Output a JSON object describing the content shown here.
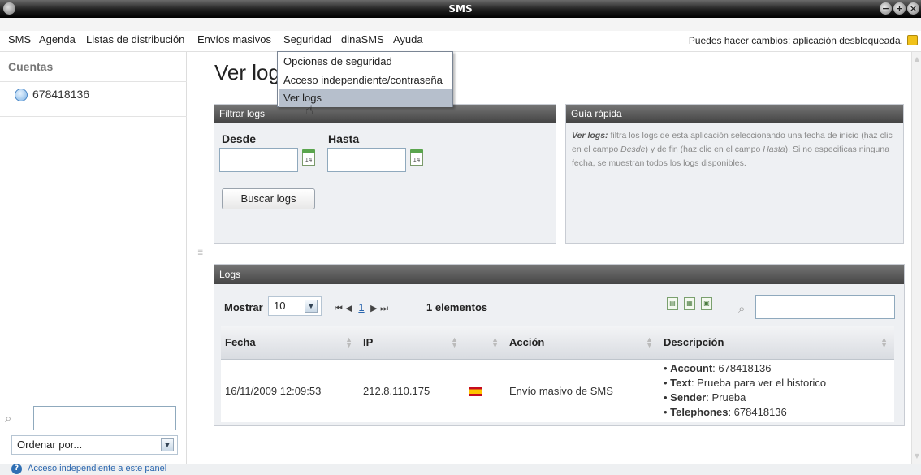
{
  "window": {
    "title": "SMS"
  },
  "menubar": {
    "items": [
      "SMS",
      "Agenda",
      "Listas de distribución",
      "Envíos masivos",
      "Seguridad",
      "dinaSMS",
      "Ayuda"
    ],
    "status": "Puedes hacer cambios: aplicación desbloqueada."
  },
  "dropdown": {
    "items": [
      "Opciones de seguridad",
      "Acceso independiente/contraseña",
      "Ver logs"
    ],
    "highlighted": "Ver logs"
  },
  "sidebar": {
    "title": "Cuentas",
    "accounts": [
      "678418136"
    ],
    "search_value": "",
    "sort_label": "Ordenar por..."
  },
  "footer": {
    "link": "Acceso independiente a este panel"
  },
  "page": {
    "title": "Ver logs"
  },
  "filter": {
    "title": "Filtrar logs",
    "from_label": "Desde",
    "to_label": "Hasta",
    "from_value": "",
    "to_value": "",
    "calendar_day": "14",
    "button": "Buscar logs"
  },
  "guide": {
    "title": "Guía rápida",
    "lead": "Ver logs:",
    "text_1": " filtra los logs de esta aplicación seleccionando una fecha de inicio (haz clic en el campo ",
    "em_1": "Desde",
    "text_2": ") y de fin (haz clic en el campo ",
    "em_2": "Hasta",
    "text_3": "). Si no especificas ninguna fecha, se muestran todos los logs disponibles."
  },
  "logs": {
    "title": "Logs",
    "show_label": "Mostrar",
    "page_size": "10",
    "pager": {
      "first": "⏮",
      "prev": "◀",
      "page": "1",
      "next": "▶",
      "last": "⏭"
    },
    "count": "1 elementos",
    "search_value": "",
    "columns": [
      "Fecha",
      "IP",
      "",
      "Acción",
      "Descripción"
    ],
    "rows": [
      {
        "fecha": "16/11/2009 12:09:53",
        "ip": "212.8.110.175",
        "accion": "Envío masivo de SMS",
        "descripcion": [
          {
            "key": "Account",
            "value": ": 678418136"
          },
          {
            "key": "Text",
            "value": ": Prueba para ver el historico"
          },
          {
            "key": "Sender",
            "value": ": Prueba"
          },
          {
            "key": "Telephones",
            "value": ": 678418136"
          }
        ]
      }
    ]
  },
  "icons": {
    "search": "search-icon",
    "calendar": "calendar-icon",
    "lock": "lock-icon",
    "flag": "spain-flag-icon",
    "help": "help-icon"
  }
}
